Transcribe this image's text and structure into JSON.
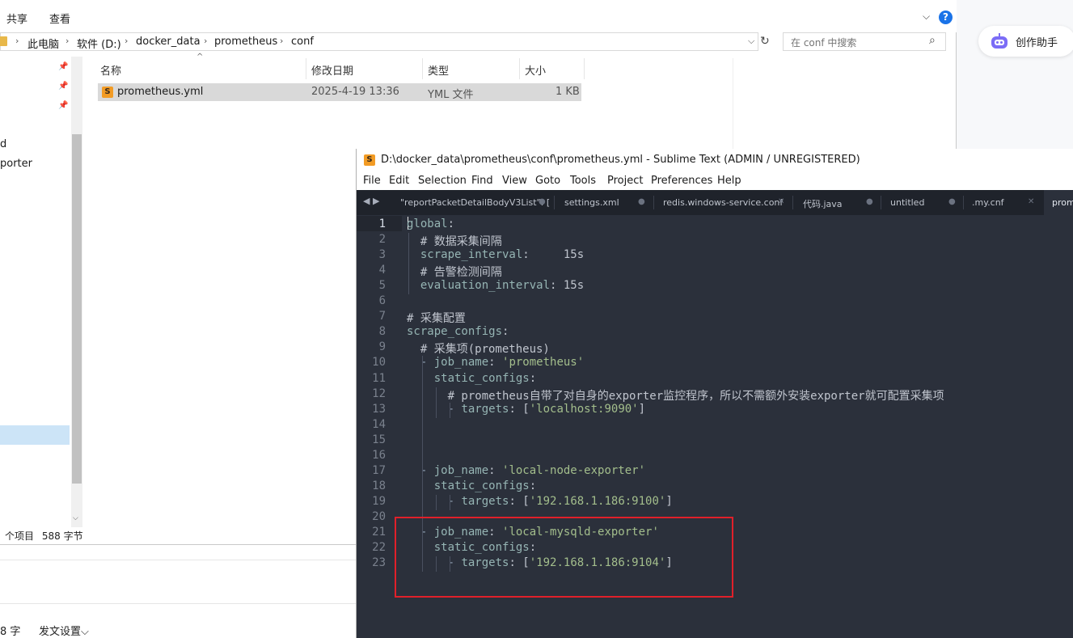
{
  "explorer": {
    "ribbon_tabs": [
      "共享",
      "查看"
    ],
    "breadcrumb": [
      "此电脑",
      "软件 (D:)",
      "docker_data",
      "prometheus",
      "conf"
    ],
    "search_placeholder": "在 conf 中搜索",
    "nav_items": [
      "d",
      "porter"
    ],
    "columns": [
      "名称",
      "修改日期",
      "类型",
      "大小"
    ],
    "files": [
      {
        "name": "prometheus.yml",
        "modified": "2025-4-19 13:36",
        "type": "YML 文件",
        "size": "1 KB"
      }
    ],
    "status": {
      "count": "个项目",
      "selection": "588 字节"
    }
  },
  "background_editor": {
    "status_left": "8 字",
    "publish_settings": "发文设置"
  },
  "assistant": {
    "label": "创作助手"
  },
  "sublime": {
    "title": "D:\\docker_data\\prometheus\\conf\\prometheus.yml - Sublime Text (ADMIN / UNREGISTERED)",
    "menu": [
      "File",
      "Edit",
      "Selection",
      "Find",
      "View",
      "Goto",
      "Tools",
      "Project",
      "Preferences",
      "Help"
    ],
    "tabs": [
      {
        "label": "\"reportPacketDetailBodyV3List\": [",
        "marker": "●"
      },
      {
        "label": "settings.xml",
        "marker": "●"
      },
      {
        "label": "redis.windows-service.conf",
        "marker": "✕"
      },
      {
        "label": "代码.java",
        "marker": "●"
      },
      {
        "label": "untitled",
        "marker": "●"
      },
      {
        "label": ".my.cnf",
        "marker": "✕"
      },
      {
        "label": "prom",
        "marker": ""
      }
    ],
    "current_line": 1,
    "lines": [
      {
        "n": "1",
        "indent": "",
        "key": "global",
        "rest": ":"
      },
      {
        "n": "2",
        "indent": "  ",
        "comment": "# 数据采集间隔"
      },
      {
        "n": "3",
        "indent": "  ",
        "key": "scrape_interval",
        "rest": ":     15s"
      },
      {
        "n": "4",
        "indent": "  ",
        "comment": "# 告警检测间隔"
      },
      {
        "n": "5",
        "indent": "  ",
        "key": "evaluation_interval",
        "rest": ": 15s"
      },
      {
        "n": "6",
        "indent": ""
      },
      {
        "n": "7",
        "indent": "",
        "comment": "# 采集配置"
      },
      {
        "n": "8",
        "indent": "",
        "key": "scrape_configs",
        "rest": ":"
      },
      {
        "n": "9",
        "indent": "  ",
        "comment": "# 采集项(prometheus)"
      },
      {
        "n": "10",
        "indent": "  ",
        "dash": "- ",
        "key": "job_name",
        "colon": ": ",
        "str": "'prometheus'"
      },
      {
        "n": "11",
        "indent": "    ",
        "key": "static_configs",
        "rest": ":"
      },
      {
        "n": "12",
        "indent": "      ",
        "comment": "# prometheus自带了对自身的exporter监控程序，所以不需额外安装exporter就可配置采集项"
      },
      {
        "n": "13",
        "indent": "      ",
        "dash": "- ",
        "key": "targets",
        "colon": ": [",
        "str": "'localhost:9090'",
        "tail": "]"
      },
      {
        "n": "14",
        "indent": ""
      },
      {
        "n": "15",
        "indent": ""
      },
      {
        "n": "16",
        "indent": ""
      },
      {
        "n": "17",
        "indent": "  ",
        "dash": "- ",
        "key": "job_name",
        "colon": ": ",
        "str": "'local-node-exporter'"
      },
      {
        "n": "18",
        "indent": "    ",
        "key": "static_configs",
        "rest": ":"
      },
      {
        "n": "19",
        "indent": "      ",
        "dash": "- ",
        "key": "targets",
        "colon": ": [",
        "str": "'192.168.1.186:9100'",
        "tail": "]"
      },
      {
        "n": "20",
        "indent": ""
      },
      {
        "n": "21",
        "indent": "  ",
        "dash": "- ",
        "key": "job_name",
        "colon": ": ",
        "str": "'local-mysqld-exporter'"
      },
      {
        "n": "22",
        "indent": "    ",
        "key": "static_configs",
        "rest": ":"
      },
      {
        "n": "23",
        "indent": "      ",
        "dash": "- ",
        "key": "targets",
        "colon": ": [",
        "str": "'192.168.1.186:9104'",
        "tail": "]"
      }
    ]
  },
  "colors": {
    "highlight_box": "#e0202a",
    "editor_bg": "#2b303b",
    "selection_blue": "#cce4f7"
  }
}
